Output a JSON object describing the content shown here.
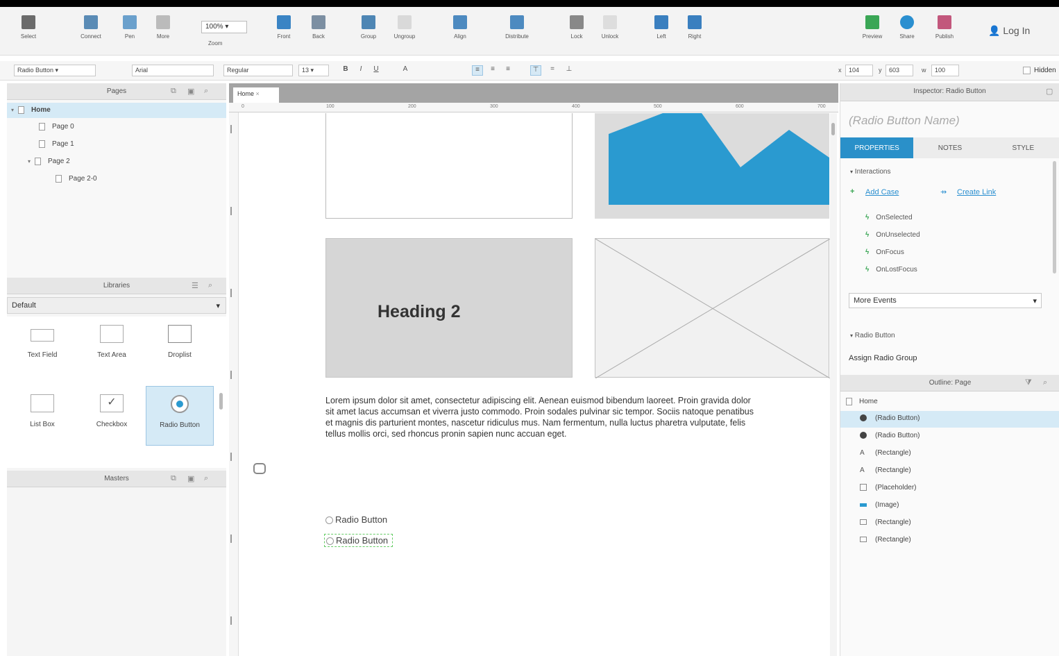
{
  "toolbar": {
    "buttons": [
      {
        "label": "Select",
        "icon": "select-icon"
      },
      {
        "label": "Connect",
        "icon": "connect-icon"
      },
      {
        "label": "Pen",
        "icon": "pen-icon"
      },
      {
        "label": "More",
        "icon": "more-icon"
      },
      {
        "label": "Zoom",
        "icon": "zoom-icon"
      },
      {
        "label": "Front",
        "icon": "bring-front-icon"
      },
      {
        "label": "Back",
        "icon": "send-back-icon"
      },
      {
        "label": "Group",
        "icon": "group-icon"
      },
      {
        "label": "Ungroup",
        "icon": "ungroup-icon"
      },
      {
        "label": "Align",
        "icon": "align-icon"
      },
      {
        "label": "Distribute",
        "icon": "distribute-icon"
      },
      {
        "label": "Lock",
        "icon": "lock-icon"
      },
      {
        "label": "Unlock",
        "icon": "unlock-icon"
      },
      {
        "label": "Left",
        "icon": "left-panel-icon"
      },
      {
        "label": "Right",
        "icon": "right-panel-icon"
      },
      {
        "label": "Preview",
        "icon": "preview-icon"
      },
      {
        "label": "Share",
        "icon": "share-icon"
      },
      {
        "label": "Publish",
        "icon": "publish-icon"
      }
    ],
    "zoom_value": "100%",
    "login_label": "Log In"
  },
  "format_bar": {
    "widget_type": "Radio Button",
    "font": "Arial",
    "weight": "Regular",
    "size": "13",
    "x_label": "x",
    "x_value": "104",
    "y_label": "y",
    "y_value": "603",
    "w_label": "w",
    "w_value": "100",
    "hidden_label": "Hidden"
  },
  "pages_panel": {
    "title": "Pages",
    "items": [
      "Home",
      "Page 0",
      "Page 1",
      "Page 2",
      "Page 2-0"
    ]
  },
  "libraries_panel": {
    "title": "Libraries",
    "selected_library": "Default",
    "widgets": [
      "Text Field",
      "Text Area",
      "Droplist",
      "List Box",
      "Checkbox",
      "Radio Button"
    ]
  },
  "masters_panel": {
    "title": "Masters"
  },
  "canvas": {
    "tab_label": "Home",
    "ruler_labels": [
      "0",
      "100",
      "200",
      "300",
      "400",
      "500",
      "600",
      "700"
    ],
    "heading": "Heading 2",
    "paragraph": "Lorem ipsum dolor sit amet, consectetur adipiscing elit. Aenean euismod bibendum laoreet. Proin gravida dolor sit amet lacus accumsan et viverra justo commodo. Proin sodales pulvinar sic tempor. Sociis natoque penatibus et magnis dis parturient montes, nascetur ridiculus mus. Nam fermentum, nulla luctus pharetra vulputate, felis tellus mollis orci, sed rhoncus pronin sapien nunc accuan eget.",
    "radio1": "Radio Button",
    "radio2": "Radio Button",
    "chart_fill": "#2a9ad0"
  },
  "inspector": {
    "title": "Inspector: Radio Button",
    "name_placeholder": "(Radio Button Name)",
    "tabs": [
      "PROPERTIES",
      "NOTES",
      "STYLE"
    ],
    "interactions_label": "Interactions",
    "add_case": "Add Case",
    "create_link": "Create Link",
    "events": [
      "OnSelected",
      "OnUnselected",
      "OnFocus",
      "OnLostFocus"
    ],
    "more_events": "More Events",
    "radio_section": "Radio Button",
    "assign_group": "Assign Radio Group"
  },
  "outline": {
    "title": "Outline: Page",
    "root": "Home",
    "items": [
      {
        "label": "(Radio Button)",
        "icon": "radio-icon"
      },
      {
        "label": "(Radio Button)",
        "icon": "radio-icon"
      },
      {
        "label": "(Rectangle)",
        "icon": "text-icon"
      },
      {
        "label": "(Rectangle)",
        "icon": "text-icon"
      },
      {
        "label": "(Placeholder)",
        "icon": "placeholder-icon"
      },
      {
        "label": "(Image)",
        "icon": "image-icon"
      },
      {
        "label": "(Rectangle)",
        "icon": "rectangle-icon"
      },
      {
        "label": "(Rectangle)",
        "icon": "rectangle-icon"
      }
    ]
  },
  "colors": {
    "accent": "#2a90c9",
    "selection": "#d5eaf6",
    "event_bolt": "#3aa655"
  }
}
